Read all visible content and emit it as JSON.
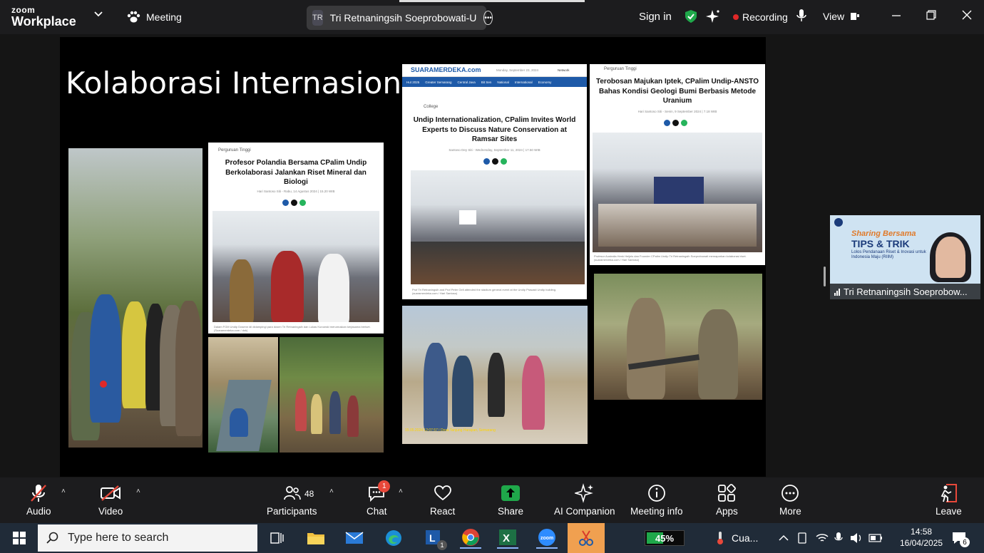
{
  "topbar": {
    "brand_line1": "zoom",
    "brand_line2": "Workplace",
    "meeting_label": "Meeting",
    "speaker_initials": "TR",
    "speaker_name": "Tri Retnaningsih Soeprobowati-U",
    "sign_in": "Sign in",
    "recording": "Recording",
    "view": "View"
  },
  "slide": {
    "title": "Kolaborasi Internasional",
    "card1": {
      "category": "Perguruan Tinggi",
      "headline": "Profesor Polandia Bersama CPalim Undip Berkolaborasi Jalankan Riset Mineral dan Biologi",
      "meta": "Hari Santoso Siti - Rabu, 14 Agustus 2024 | 15.20 WIB",
      "caption": "Dalam FGM Undip Dosenn idi didampingi para dosen Tri Retnaningsih dan Lukas Kurowski merumuskan kerjasama beriset. (Suaramerdeka.com / dok)"
    },
    "card2": {
      "logo": "SUARAMERDEKA.com",
      "date": "Monday, September 23, 2024",
      "network": "Network",
      "nav": [
        "Hut 2025",
        "Greater Semarang",
        "Central Java",
        "Bit Sen",
        "National",
        "International",
        "Economy"
      ],
      "category": "College",
      "headline": "Undip Internationalization, CPalim Invites World Experts to Discuss Nature Conservation at Ramsar Sites",
      "meta": "Santoso Dey Siti - Wednesday, September 11, 2024 | 17.50 WIB",
      "caption": "Prof Tri Retnaningsih and Prof Peter Gell attended the stadium general event at the Undip Prasasti Undip building. (suaramerdeka.com / Hari Santoso)"
    },
    "card3": {
      "category": "Perguruan Tinggi",
      "headline": "Terobosan Majukan Iptek, CPalim Undip-ANSTO Bahas Kondisi Geologi Bumi Berbasis Metode Uranium",
      "meta": "Hari Santoso Siti - Senin, 9 September 2024 | 7.18 WIB",
      "caption": "Profesor Australia Henk Heijnis dan Founder CPalim Undip Tri Retnaningsih Soeprobowati memaparkan kolaborasi riset. (suaramerdeka.com / Hari Santoso)"
    },
    "beach_caption": "15.05.2024 12:07:57 | Desa Tanjung Harapan, Semarang"
  },
  "participant_tile": {
    "banner_line1": "Sharing Bersama",
    "banner_line2": "TIPS & TRIK",
    "banner_line3": "Lolos Pendanaan Riset & Inovasi untuk Indonesia Maju (RIIM)",
    "name": "Tri Retnaningsih Soeprobow..."
  },
  "controls": {
    "audio": "Audio",
    "video": "Video",
    "participants": "Participants",
    "participants_count": "48",
    "chat": "Chat",
    "chat_badge": "1",
    "react": "React",
    "share": "Share",
    "ai_companion": "AI Companion",
    "meeting_info": "Meeting info",
    "apps": "Apps",
    "more": "More",
    "leave": "Leave",
    "share_color": "#1fa84a",
    "leave_color": "#e8483a"
  },
  "taskbar": {
    "search_placeholder": "Type here to search",
    "battery": "45%",
    "battery_level": 0.45,
    "weather": "Cua...",
    "time": "14:58",
    "date": "16/04/2025",
    "notifications": "6",
    "lync_badge": "1"
  }
}
